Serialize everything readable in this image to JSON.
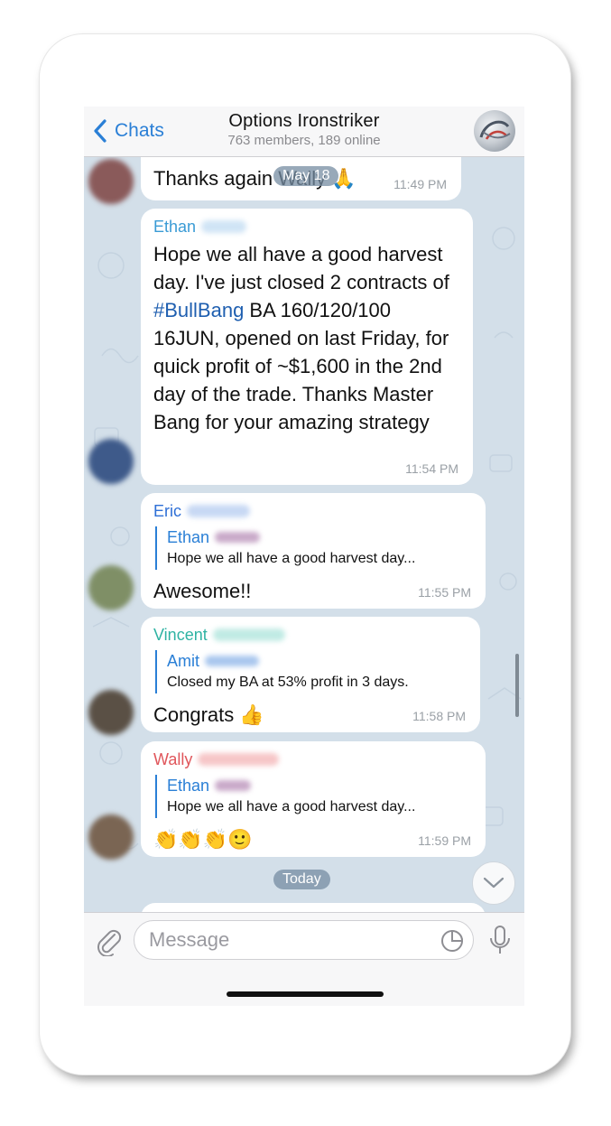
{
  "header": {
    "back_label": "Chats",
    "title": "Options Ironstriker",
    "subtitle": "763 members, 189 online"
  },
  "date_pills": {
    "top": "May 18",
    "today": "Today"
  },
  "messages": [
    {
      "sender": "",
      "text": "Thanks again Wally 🙏",
      "time": "11:49 PM"
    },
    {
      "sender": "Ethan",
      "sender_color": "#3a9bd5",
      "text_parts": [
        "Hope we all have a good harvest day. I've just closed 2 contracts of ",
        "#BullBang",
        " BA 160/120/100 16JUN, opened on last Friday, for quick profit of ~$1,600 in the 2nd day of the trade. Thanks Master Bang for your amazing strategy"
      ],
      "time": "11:54 PM"
    },
    {
      "sender": "Eric",
      "sender_color": "#2e6fd6",
      "reply_name": "Ethan",
      "reply_text": "Hope we all have a good harvest day...",
      "text": "Awesome!!",
      "time": "11:55 PM"
    },
    {
      "sender": "Vincent",
      "sender_color": "#2fb3a3",
      "reply_name": "Amit",
      "reply_text": "Closed my BA at 53% profit in 3 days.",
      "text": "Congrats 👍",
      "time": "11:58 PM"
    },
    {
      "sender": "Wally",
      "sender_color": "#e0565b",
      "reply_name": "Ethan",
      "reply_text": "Hope we all have a good harvest day...",
      "text": "👏👏👏🙂",
      "time": "11:59 PM"
    }
  ],
  "input": {
    "placeholder": "Message"
  },
  "icons": {
    "back": "chevron-left-icon",
    "attach": "paperclip-icon",
    "sticker": "sticker-icon",
    "mic": "microphone-icon",
    "scroll_down": "chevron-down-icon"
  },
  "colors": {
    "accent": "#2a7fd6",
    "chat_bg": "#d3dfe9"
  }
}
